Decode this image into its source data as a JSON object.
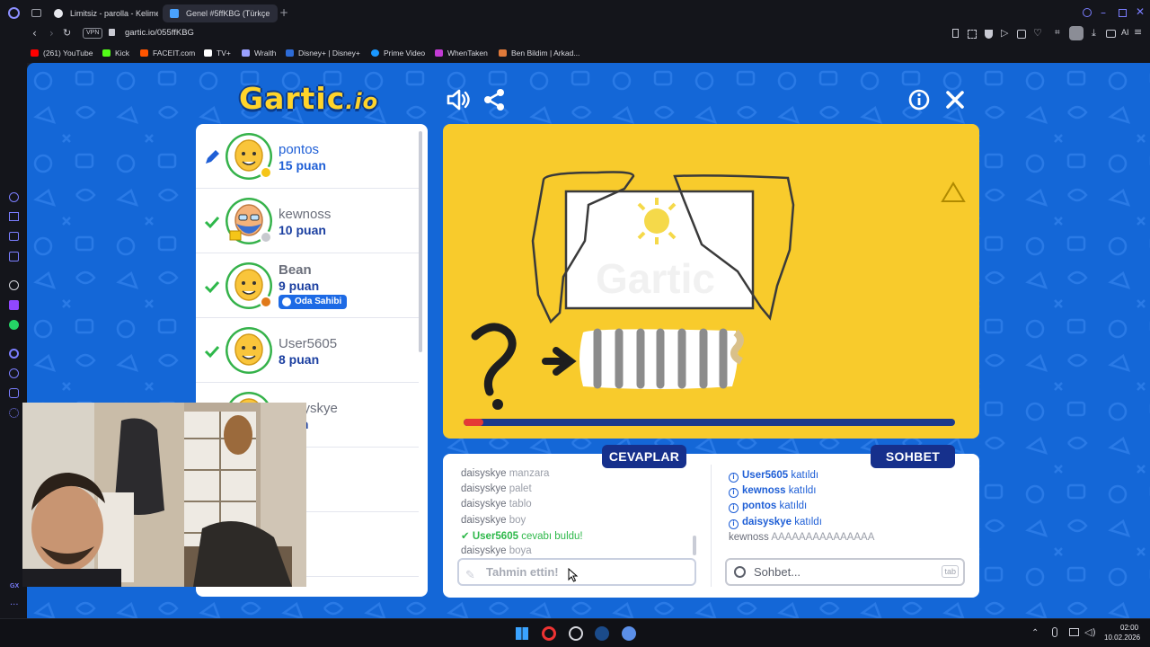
{
  "browser": {
    "tabs": [
      {
        "label": "Limitsiz - parolla - Kelime",
        "active": false
      },
      {
        "label": "Genel #5ffKBG (Türkçe",
        "active": true
      }
    ],
    "vpn_label": "VPN",
    "url": "gartic.io/055ffKBG",
    "bookmarks": [
      {
        "label": "(261) YouTube",
        "color": "#ff0000"
      },
      {
        "label": "Kick",
        "color": "#53fc18"
      },
      {
        "label": "FACEIT.com",
        "color": "#ff5500"
      },
      {
        "label": "TV+",
        "color": "#ffffff"
      },
      {
        "label": "Wraith",
        "color": "#9aa0ff"
      },
      {
        "label": "Disney+ | Disney+",
        "color": "#1a3a9a"
      },
      {
        "label": "Prime Video",
        "color": "#1a98ff"
      },
      {
        "label": "WhenTaken",
        "color": "#c23bd4"
      },
      {
        "label": "Ben Bildim | Arkad...",
        "color": "#e07a3a"
      }
    ],
    "ai_label": "AI",
    "gx_label": "GX"
  },
  "game": {
    "logo_main": "Gartic",
    "logo_suffix": ".io",
    "players": [
      {
        "name": "pontos",
        "score": "15 puan",
        "status": "drawing"
      },
      {
        "name": "kewnoss",
        "score": "10 puan",
        "status": "guessed"
      },
      {
        "name": "Bean",
        "score": "9 puan",
        "status": "guessed",
        "badge": "Oda Sahibi"
      },
      {
        "name": "User5605",
        "score": "8 puan",
        "status": "guessed"
      },
      {
        "name": "daisyskye",
        "score": "puan",
        "status": "none"
      }
    ],
    "timer_progress": 0.04,
    "answers_tab": "CEVAPLAR",
    "chat_tab": "SOHBET",
    "answers": [
      {
        "who": "daisyskye",
        "text": "manzara"
      },
      {
        "who": "daisyskye",
        "text": "palet"
      },
      {
        "who": "daisyskye",
        "text": "tablo"
      },
      {
        "who": "daisyskye",
        "text": "boy"
      },
      {
        "who": "User5605",
        "text": "cevabı buldu!",
        "correct": true
      },
      {
        "who": "daisyskye",
        "text": "boya"
      }
    ],
    "chat": [
      {
        "who": "User5605",
        "text": "katıldı",
        "system": true
      },
      {
        "who": "kewnoss",
        "text": "katıldı",
        "system": true
      },
      {
        "who": "pontos",
        "text": "katıldı",
        "system": true
      },
      {
        "who": "daisyskye",
        "text": "katıldı",
        "system": true
      },
      {
        "who": "kewnoss",
        "text": "AAAAAAAAAAAAAAA",
        "system": false
      }
    ],
    "guess_placeholder": "Tahmin ettin!",
    "chat_placeholder": "Sohbet...",
    "chat_key_hint": "tab",
    "watermark": "Gartic"
  },
  "taskbar": {
    "time": "02:00",
    "date": "10.02.2026"
  },
  "colors": {
    "page_bg": "#1467d7",
    "canvas_bg": "#f8cb2c",
    "accent_dark": "#16308c",
    "correct": "#2eb84a"
  }
}
